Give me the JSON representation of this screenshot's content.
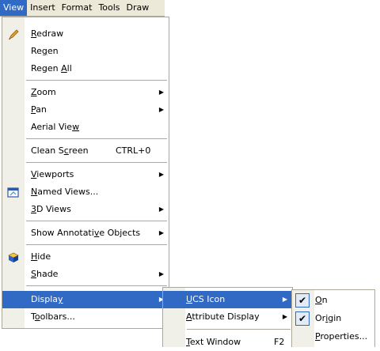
{
  "menubar": [
    "View",
    "Insert",
    "Format",
    "Tools",
    "Draw"
  ],
  "view_menu": {
    "redraw": {
      "before": "",
      "key": "R",
      "after": "edraw"
    },
    "regen": {
      "before": "Re",
      "key": "g",
      "after": "en"
    },
    "regen_all": {
      "before": "Regen ",
      "key": "A",
      "after": "ll"
    },
    "zoom": {
      "before": "",
      "key": "Z",
      "after": "oom"
    },
    "pan": {
      "before": "",
      "key": "P",
      "after": "an"
    },
    "aerial_view": {
      "before": "Aerial Vie",
      "key": "w",
      "after": ""
    },
    "clean_screen": {
      "before": "Clean S",
      "key": "c",
      "after": "reen"
    },
    "clean_screen_shortcut": "CTRL+0",
    "viewports": {
      "before": "",
      "key": "V",
      "after": "iewports"
    },
    "named_views": {
      "before": "",
      "key": "N",
      "after": "amed Views..."
    },
    "views_3d": {
      "before": "",
      "key": "3",
      "after": "D Views"
    },
    "show_annotative": {
      "before": "Show Annotati",
      "key": "v",
      "after": "e Objects"
    },
    "hide": {
      "before": "",
      "key": "H",
      "after": "ide"
    },
    "shade": {
      "before": "",
      "key": "S",
      "after": "hade"
    },
    "display": {
      "before": "Displa",
      "key": "y",
      "after": ""
    },
    "toolbars": {
      "before": "T",
      "key": "o",
      "after": "olbars..."
    }
  },
  "display_submenu": {
    "ucs_icon": {
      "before": "",
      "key": "U",
      "after": "CS Icon"
    },
    "attribute_display": {
      "before": "",
      "key": "A",
      "after": "ttribute Display"
    },
    "text_window": {
      "before": "",
      "key": "T",
      "after": "ext Window"
    },
    "text_window_shortcut": "F2"
  },
  "ucs_submenu": {
    "on": {
      "before": "",
      "key": "O",
      "after": "n"
    },
    "origin": {
      "before": "Or",
      "key": "i",
      "after": "gin"
    },
    "properties": {
      "before": "",
      "key": "P",
      "after": "roperties..."
    }
  },
  "colors": {
    "highlight": "#316ac5",
    "menu_face": "#ece9d8",
    "border": "#aca899"
  }
}
